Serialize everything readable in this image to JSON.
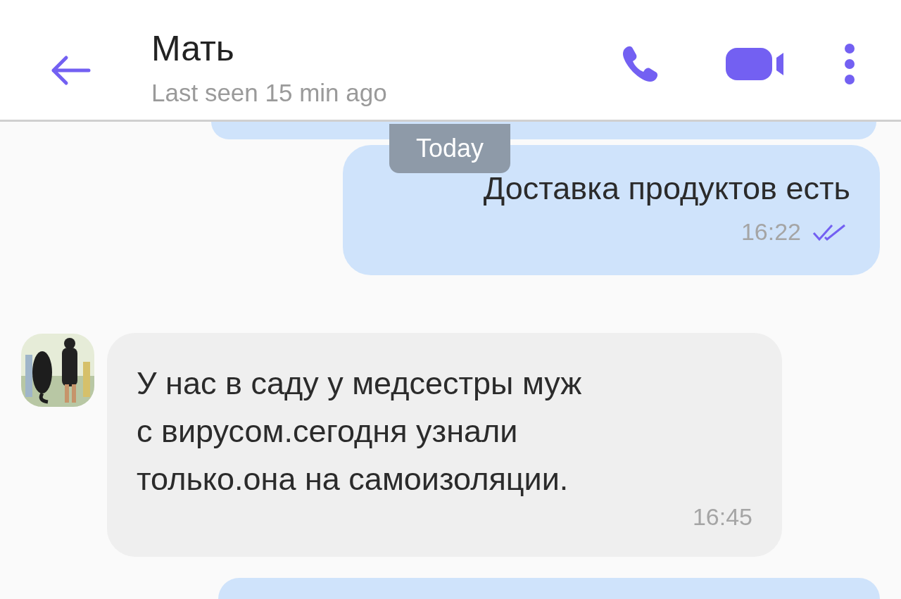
{
  "header": {
    "title": "Мать",
    "subtitle": "Last seen 15 min ago"
  },
  "date_badge": "Today",
  "messages": [
    {
      "kind": "outgoing",
      "text": "Доставка продуктов есть",
      "time": "16:22",
      "read": true
    },
    {
      "kind": "incoming",
      "text": "У нас в саду у медсестры муж\nс вирусом.сегодня узнали\nтолько.она на самоизоляции.",
      "time": "16:45"
    }
  ]
}
